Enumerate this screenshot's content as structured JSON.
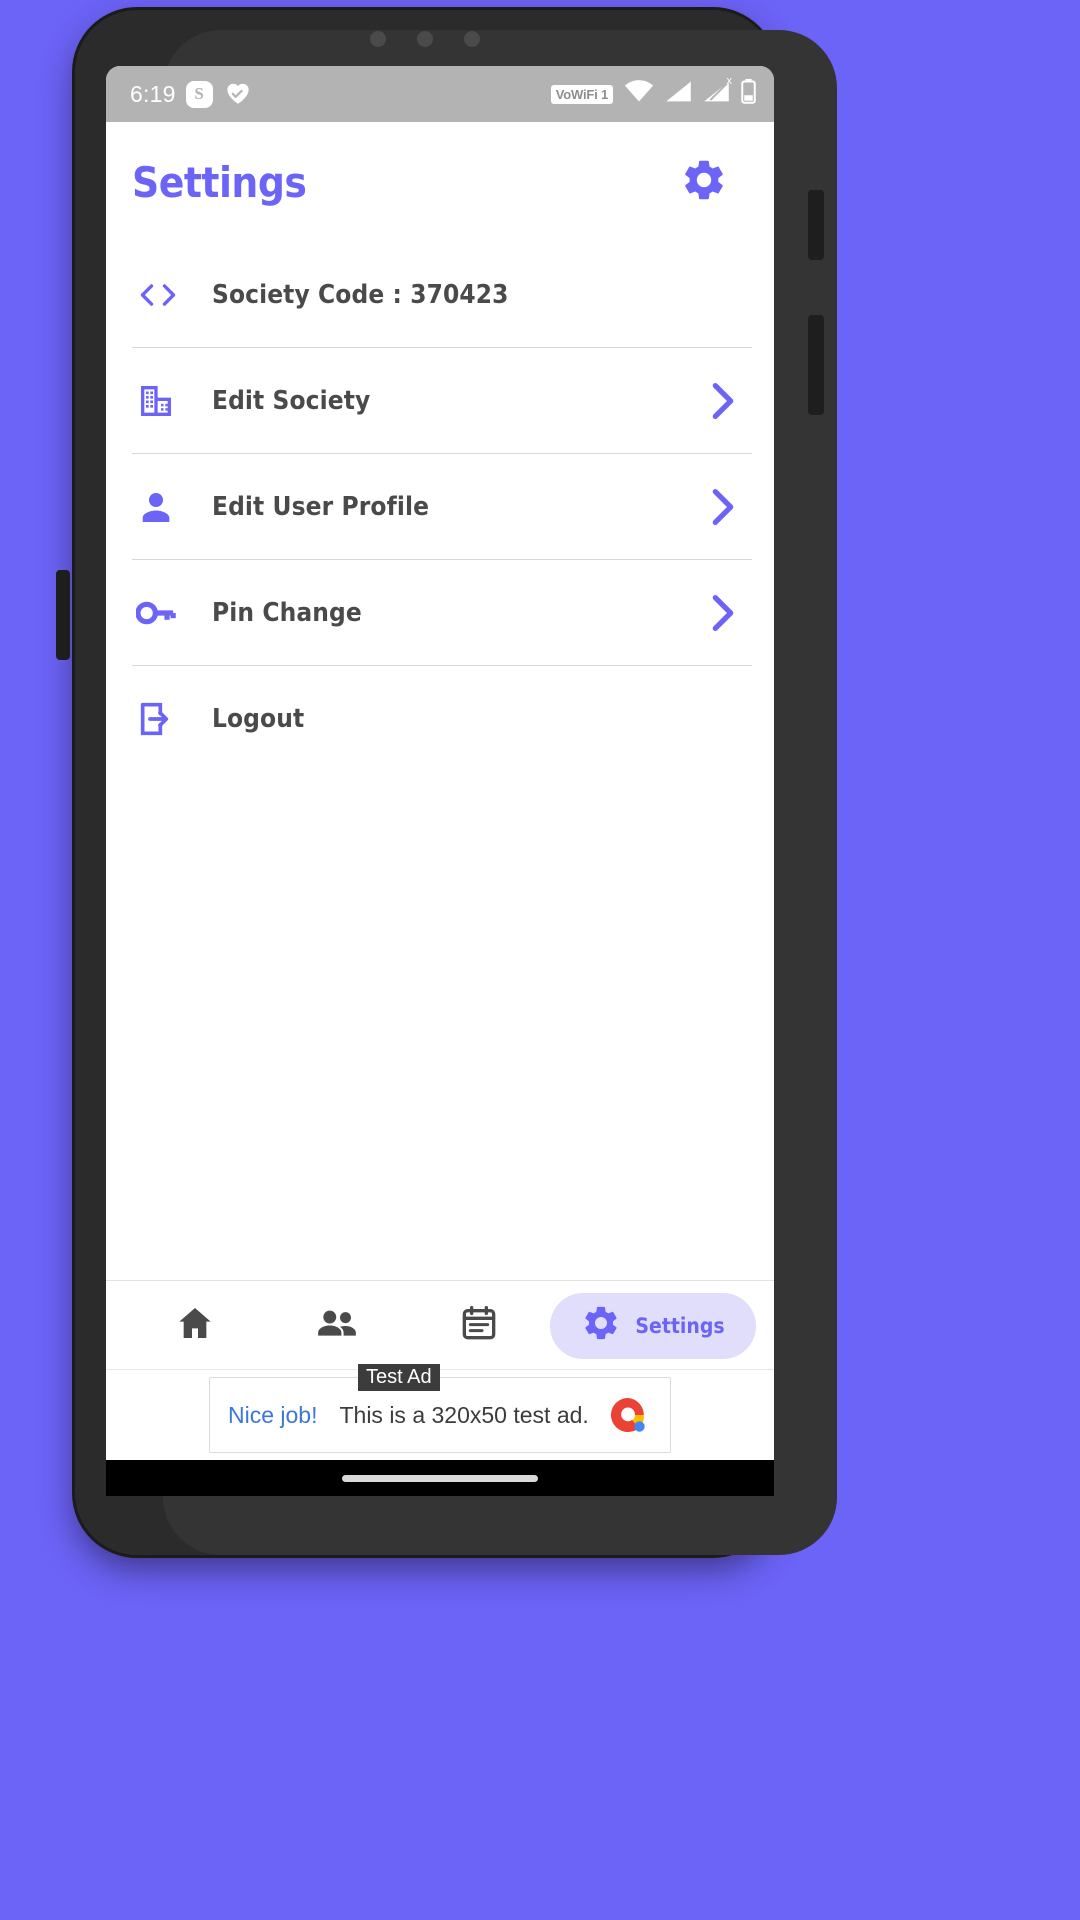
{
  "theme": {
    "accent": "#6C63F7",
    "accent_soft": "#E0DEFB",
    "label_color": "#4a4a4a",
    "divider": "#d8d8d8",
    "status_bar_bg": "#b3b3b3",
    "screen_bg": "#ffffff",
    "wallpaper": "#6C63F7"
  },
  "status_bar": {
    "time": "6:19",
    "left_icons": [
      {
        "name": "skype-icon",
        "glyph": "S"
      },
      {
        "name": "heart-health-icon",
        "glyph": "heart"
      }
    ],
    "vowifi_badge": "VoWiFi 1",
    "right_icons": [
      {
        "name": "wifi-icon"
      },
      {
        "name": "signal-bar-icon"
      },
      {
        "name": "signal-no-sim-icon",
        "superscript": "x"
      },
      {
        "name": "battery-icon"
      }
    ]
  },
  "header": {
    "title": "Settings",
    "gear_icon": "gear-icon"
  },
  "settings_list": [
    {
      "id": "society-code",
      "icon": "code-brackets-icon",
      "label": "Society Code : 370423",
      "chevron": false,
      "divider_below": true
    },
    {
      "id": "edit-society",
      "icon": "building-icon",
      "label": "Edit Society",
      "chevron": true,
      "divider_below": true
    },
    {
      "id": "edit-user-profile",
      "icon": "person-icon",
      "label": "Edit User Profile",
      "chevron": true,
      "divider_below": true
    },
    {
      "id": "pin-change",
      "icon": "key-icon",
      "label": "Pin Change",
      "chevron": true,
      "divider_below": true
    },
    {
      "id": "logout",
      "icon": "logout-icon",
      "label": "Logout",
      "chevron": false,
      "divider_below": false
    }
  ],
  "bottom_nav": [
    {
      "id": "home",
      "icon": "home-icon",
      "label": "",
      "active": false
    },
    {
      "id": "members",
      "icon": "people-icon",
      "label": "",
      "active": false
    },
    {
      "id": "calendar",
      "icon": "calendar-icon",
      "label": "",
      "active": false
    },
    {
      "id": "settings",
      "icon": "gear-icon",
      "label": "Settings",
      "active": true
    }
  ],
  "ad_banner": {
    "cta": "Nice job!",
    "text": "This is a 320x50 test ad.",
    "badge": "Test Ad",
    "logo": "google-ads-logo"
  }
}
